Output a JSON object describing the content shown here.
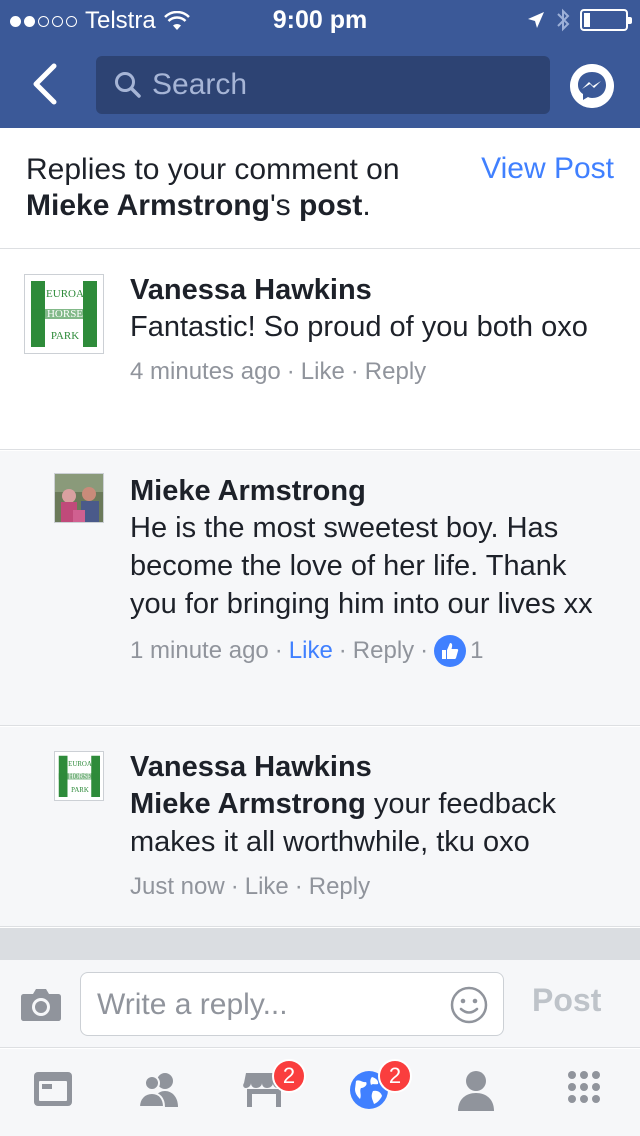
{
  "status_bar": {
    "carrier": "Telstra",
    "time": "9:00 pm",
    "signal_bars_filled": 2,
    "signal_bars_total": 5,
    "battery_level": 0.1
  },
  "nav": {
    "search_placeholder": "Search"
  },
  "header": {
    "line_prefix": "Replies to your comment on",
    "author": "Mieke Armstrong",
    "author_suffix": "'s",
    "post_word": "post",
    "period": ".",
    "view_post_label": "View Post"
  },
  "comments": [
    {
      "name": "Vanessa Hawkins",
      "text": "Fantastic! So proud of you both oxo",
      "time": "4 minutes ago",
      "like": "Like",
      "reply": "Reply"
    },
    {
      "name": "Mieke Armstrong",
      "text": "He is the most sweetest boy. Has become the love of her life. Thank you for bringing him into our lives xx",
      "time": "1 minute ago",
      "like": "Like",
      "reply": "Reply",
      "like_count": "1"
    },
    {
      "name": "Vanessa Hawkins",
      "mention": "Mieke Armstrong",
      "text": " your feedback makes it all worthwhile, tku oxo",
      "time": "Just now",
      "like": "Like",
      "reply": "Reply"
    }
  ],
  "composer": {
    "placeholder": "Write a reply...",
    "post_label": "Post"
  },
  "tabbar": {
    "marketplace_badge": "2",
    "notifications_badge": "2"
  },
  "colors": {
    "brand": "#3b5998",
    "link": "#4080ff",
    "badge": "#fa3e3e"
  },
  "avatar_logo": {
    "line1": "EUROA",
    "line2": "HORSE",
    "line3": "PARK"
  }
}
